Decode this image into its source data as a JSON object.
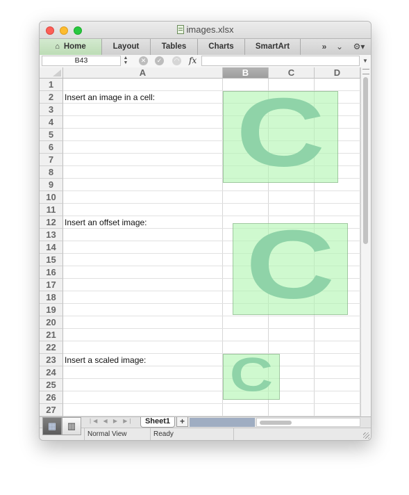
{
  "window": {
    "title": "images.xlsx"
  },
  "ribbon": {
    "tabs": [
      "Home",
      "Layout",
      "Tables",
      "Charts",
      "SmartArt"
    ],
    "icons": [
      "home-icon",
      "more-chevrons-icon",
      "collapse-chevron-icon",
      "gear-icon"
    ]
  },
  "formula_bar": {
    "name_box": "B43",
    "formula": "",
    "fx_label": "fx"
  },
  "sheet": {
    "columns": [
      "A",
      "B",
      "C",
      "D"
    ],
    "selected_column": "B",
    "rows": [
      "1",
      "2",
      "3",
      "4",
      "5",
      "6",
      "7",
      "8",
      "9",
      "10",
      "11",
      "12",
      "13",
      "14",
      "15",
      "16",
      "17",
      "18",
      "19",
      "20",
      "21",
      "22",
      "23",
      "24",
      "25",
      "26",
      "27"
    ],
    "cells": {
      "a2": "Insert an image in a cell:",
      "a12": "Insert an offset image:",
      "a23": "Insert a scaled image:"
    },
    "image_letter": "C",
    "image_color": "#8fd3a8"
  },
  "sheet_tabs": {
    "active": "Sheet1",
    "add_label": "+"
  },
  "status": {
    "view": "Normal View",
    "state": "Ready"
  }
}
